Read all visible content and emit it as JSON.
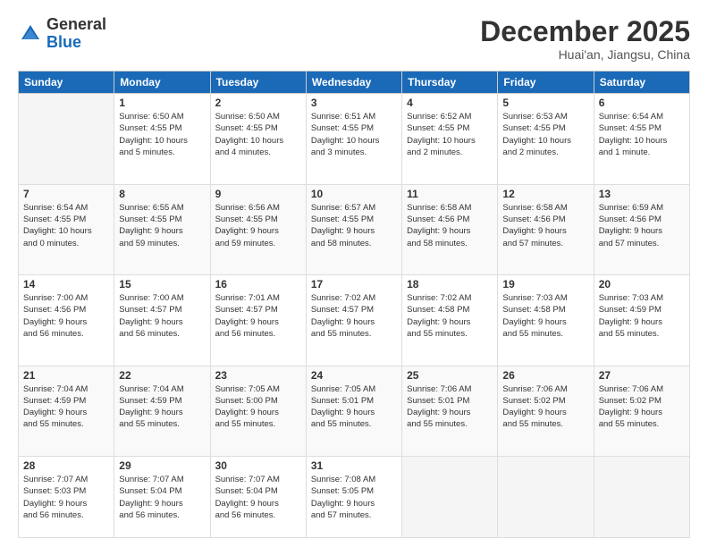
{
  "logo": {
    "general": "General",
    "blue": "Blue"
  },
  "title": "December 2025",
  "location": "Huai'an, Jiangsu, China",
  "days_of_week": [
    "Sunday",
    "Monday",
    "Tuesday",
    "Wednesday",
    "Thursday",
    "Friday",
    "Saturday"
  ],
  "weeks": [
    [
      {
        "day": "",
        "info": ""
      },
      {
        "day": "1",
        "info": "Sunrise: 6:50 AM\nSunset: 4:55 PM\nDaylight: 10 hours\nand 5 minutes."
      },
      {
        "day": "2",
        "info": "Sunrise: 6:50 AM\nSunset: 4:55 PM\nDaylight: 10 hours\nand 4 minutes."
      },
      {
        "day": "3",
        "info": "Sunrise: 6:51 AM\nSunset: 4:55 PM\nDaylight: 10 hours\nand 3 minutes."
      },
      {
        "day": "4",
        "info": "Sunrise: 6:52 AM\nSunset: 4:55 PM\nDaylight: 10 hours\nand 2 minutes."
      },
      {
        "day": "5",
        "info": "Sunrise: 6:53 AM\nSunset: 4:55 PM\nDaylight: 10 hours\nand 2 minutes."
      },
      {
        "day": "6",
        "info": "Sunrise: 6:54 AM\nSunset: 4:55 PM\nDaylight: 10 hours\nand 1 minute."
      }
    ],
    [
      {
        "day": "7",
        "info": "Sunrise: 6:54 AM\nSunset: 4:55 PM\nDaylight: 10 hours\nand 0 minutes."
      },
      {
        "day": "8",
        "info": "Sunrise: 6:55 AM\nSunset: 4:55 PM\nDaylight: 9 hours\nand 59 minutes."
      },
      {
        "day": "9",
        "info": "Sunrise: 6:56 AM\nSunset: 4:55 PM\nDaylight: 9 hours\nand 59 minutes."
      },
      {
        "day": "10",
        "info": "Sunrise: 6:57 AM\nSunset: 4:55 PM\nDaylight: 9 hours\nand 58 minutes."
      },
      {
        "day": "11",
        "info": "Sunrise: 6:58 AM\nSunset: 4:56 PM\nDaylight: 9 hours\nand 58 minutes."
      },
      {
        "day": "12",
        "info": "Sunrise: 6:58 AM\nSunset: 4:56 PM\nDaylight: 9 hours\nand 57 minutes."
      },
      {
        "day": "13",
        "info": "Sunrise: 6:59 AM\nSunset: 4:56 PM\nDaylight: 9 hours\nand 57 minutes."
      }
    ],
    [
      {
        "day": "14",
        "info": "Sunrise: 7:00 AM\nSunset: 4:56 PM\nDaylight: 9 hours\nand 56 minutes."
      },
      {
        "day": "15",
        "info": "Sunrise: 7:00 AM\nSunset: 4:57 PM\nDaylight: 9 hours\nand 56 minutes."
      },
      {
        "day": "16",
        "info": "Sunrise: 7:01 AM\nSunset: 4:57 PM\nDaylight: 9 hours\nand 56 minutes."
      },
      {
        "day": "17",
        "info": "Sunrise: 7:02 AM\nSunset: 4:57 PM\nDaylight: 9 hours\nand 55 minutes."
      },
      {
        "day": "18",
        "info": "Sunrise: 7:02 AM\nSunset: 4:58 PM\nDaylight: 9 hours\nand 55 minutes."
      },
      {
        "day": "19",
        "info": "Sunrise: 7:03 AM\nSunset: 4:58 PM\nDaylight: 9 hours\nand 55 minutes."
      },
      {
        "day": "20",
        "info": "Sunrise: 7:03 AM\nSunset: 4:59 PM\nDaylight: 9 hours\nand 55 minutes."
      }
    ],
    [
      {
        "day": "21",
        "info": "Sunrise: 7:04 AM\nSunset: 4:59 PM\nDaylight: 9 hours\nand 55 minutes."
      },
      {
        "day": "22",
        "info": "Sunrise: 7:04 AM\nSunset: 4:59 PM\nDaylight: 9 hours\nand 55 minutes."
      },
      {
        "day": "23",
        "info": "Sunrise: 7:05 AM\nSunset: 5:00 PM\nDaylight: 9 hours\nand 55 minutes."
      },
      {
        "day": "24",
        "info": "Sunrise: 7:05 AM\nSunset: 5:01 PM\nDaylight: 9 hours\nand 55 minutes."
      },
      {
        "day": "25",
        "info": "Sunrise: 7:06 AM\nSunset: 5:01 PM\nDaylight: 9 hours\nand 55 minutes."
      },
      {
        "day": "26",
        "info": "Sunrise: 7:06 AM\nSunset: 5:02 PM\nDaylight: 9 hours\nand 55 minutes."
      },
      {
        "day": "27",
        "info": "Sunrise: 7:06 AM\nSunset: 5:02 PM\nDaylight: 9 hours\nand 55 minutes."
      }
    ],
    [
      {
        "day": "28",
        "info": "Sunrise: 7:07 AM\nSunset: 5:03 PM\nDaylight: 9 hours\nand 56 minutes."
      },
      {
        "day": "29",
        "info": "Sunrise: 7:07 AM\nSunset: 5:04 PM\nDaylight: 9 hours\nand 56 minutes."
      },
      {
        "day": "30",
        "info": "Sunrise: 7:07 AM\nSunset: 5:04 PM\nDaylight: 9 hours\nand 56 minutes."
      },
      {
        "day": "31",
        "info": "Sunrise: 7:08 AM\nSunset: 5:05 PM\nDaylight: 9 hours\nand 57 minutes."
      },
      {
        "day": "",
        "info": ""
      },
      {
        "day": "",
        "info": ""
      },
      {
        "day": "",
        "info": ""
      }
    ]
  ]
}
